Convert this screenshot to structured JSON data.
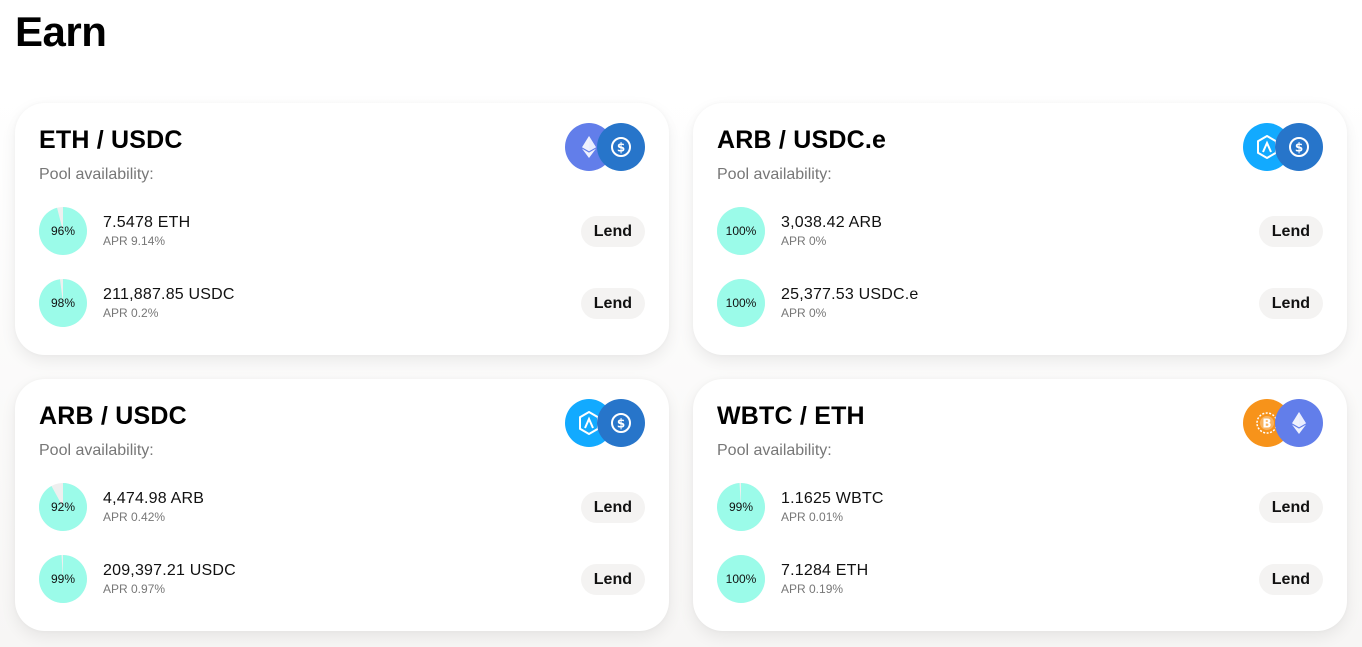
{
  "page": {
    "title": "Earn"
  },
  "labels": {
    "pool_availability": "Pool availability:",
    "lend": "Lend"
  },
  "colors": {
    "pie_fill": "#9bfbe9",
    "pie_empty": "#efefef",
    "eth": "#627eea",
    "usdc": "#2775ca",
    "arb": "#12aaff",
    "wbtc": "#f7931a"
  },
  "pools": [
    {
      "title": "ETH / USDC",
      "icons": [
        "eth-icon",
        "usdc-icon"
      ],
      "rows": [
        {
          "availability_pct": 96,
          "label": "96%",
          "amount": "7.5478 ETH",
          "apr": "APR 9.14%",
          "lend": "Lend"
        },
        {
          "availability_pct": 98,
          "label": "98%",
          "amount": "211,887.85 USDC",
          "apr": "APR 0.2%",
          "lend": "Lend"
        }
      ]
    },
    {
      "title": "ARB / USDC.e",
      "icons": [
        "arb-icon",
        "usdc-icon"
      ],
      "rows": [
        {
          "availability_pct": 100,
          "label": "100%",
          "amount": "3,038.42 ARB",
          "apr": "APR 0%",
          "lend": "Lend"
        },
        {
          "availability_pct": 100,
          "label": "100%",
          "amount": "25,377.53 USDC.e",
          "apr": "APR 0%",
          "lend": "Lend"
        }
      ]
    },
    {
      "title": "ARB / USDC",
      "icons": [
        "arb-icon",
        "usdc-icon"
      ],
      "rows": [
        {
          "availability_pct": 92,
          "label": "92%",
          "amount": "4,474.98 ARB",
          "apr": "APR 0.42%",
          "lend": "Lend"
        },
        {
          "availability_pct": 99,
          "label": "99%",
          "amount": "209,397.21 USDC",
          "apr": "APR 0.97%",
          "lend": "Lend"
        }
      ]
    },
    {
      "title": "WBTC / ETH",
      "icons": [
        "wbtc-icon",
        "eth-icon"
      ],
      "rows": [
        {
          "availability_pct": 99,
          "label": "99%",
          "amount": "1.1625 WBTC",
          "apr": "APR 0.01%",
          "lend": "Lend"
        },
        {
          "availability_pct": 100,
          "label": "100%",
          "amount": "7.1284 ETH",
          "apr": "APR 0.19%",
          "lend": "Lend"
        }
      ]
    }
  ]
}
